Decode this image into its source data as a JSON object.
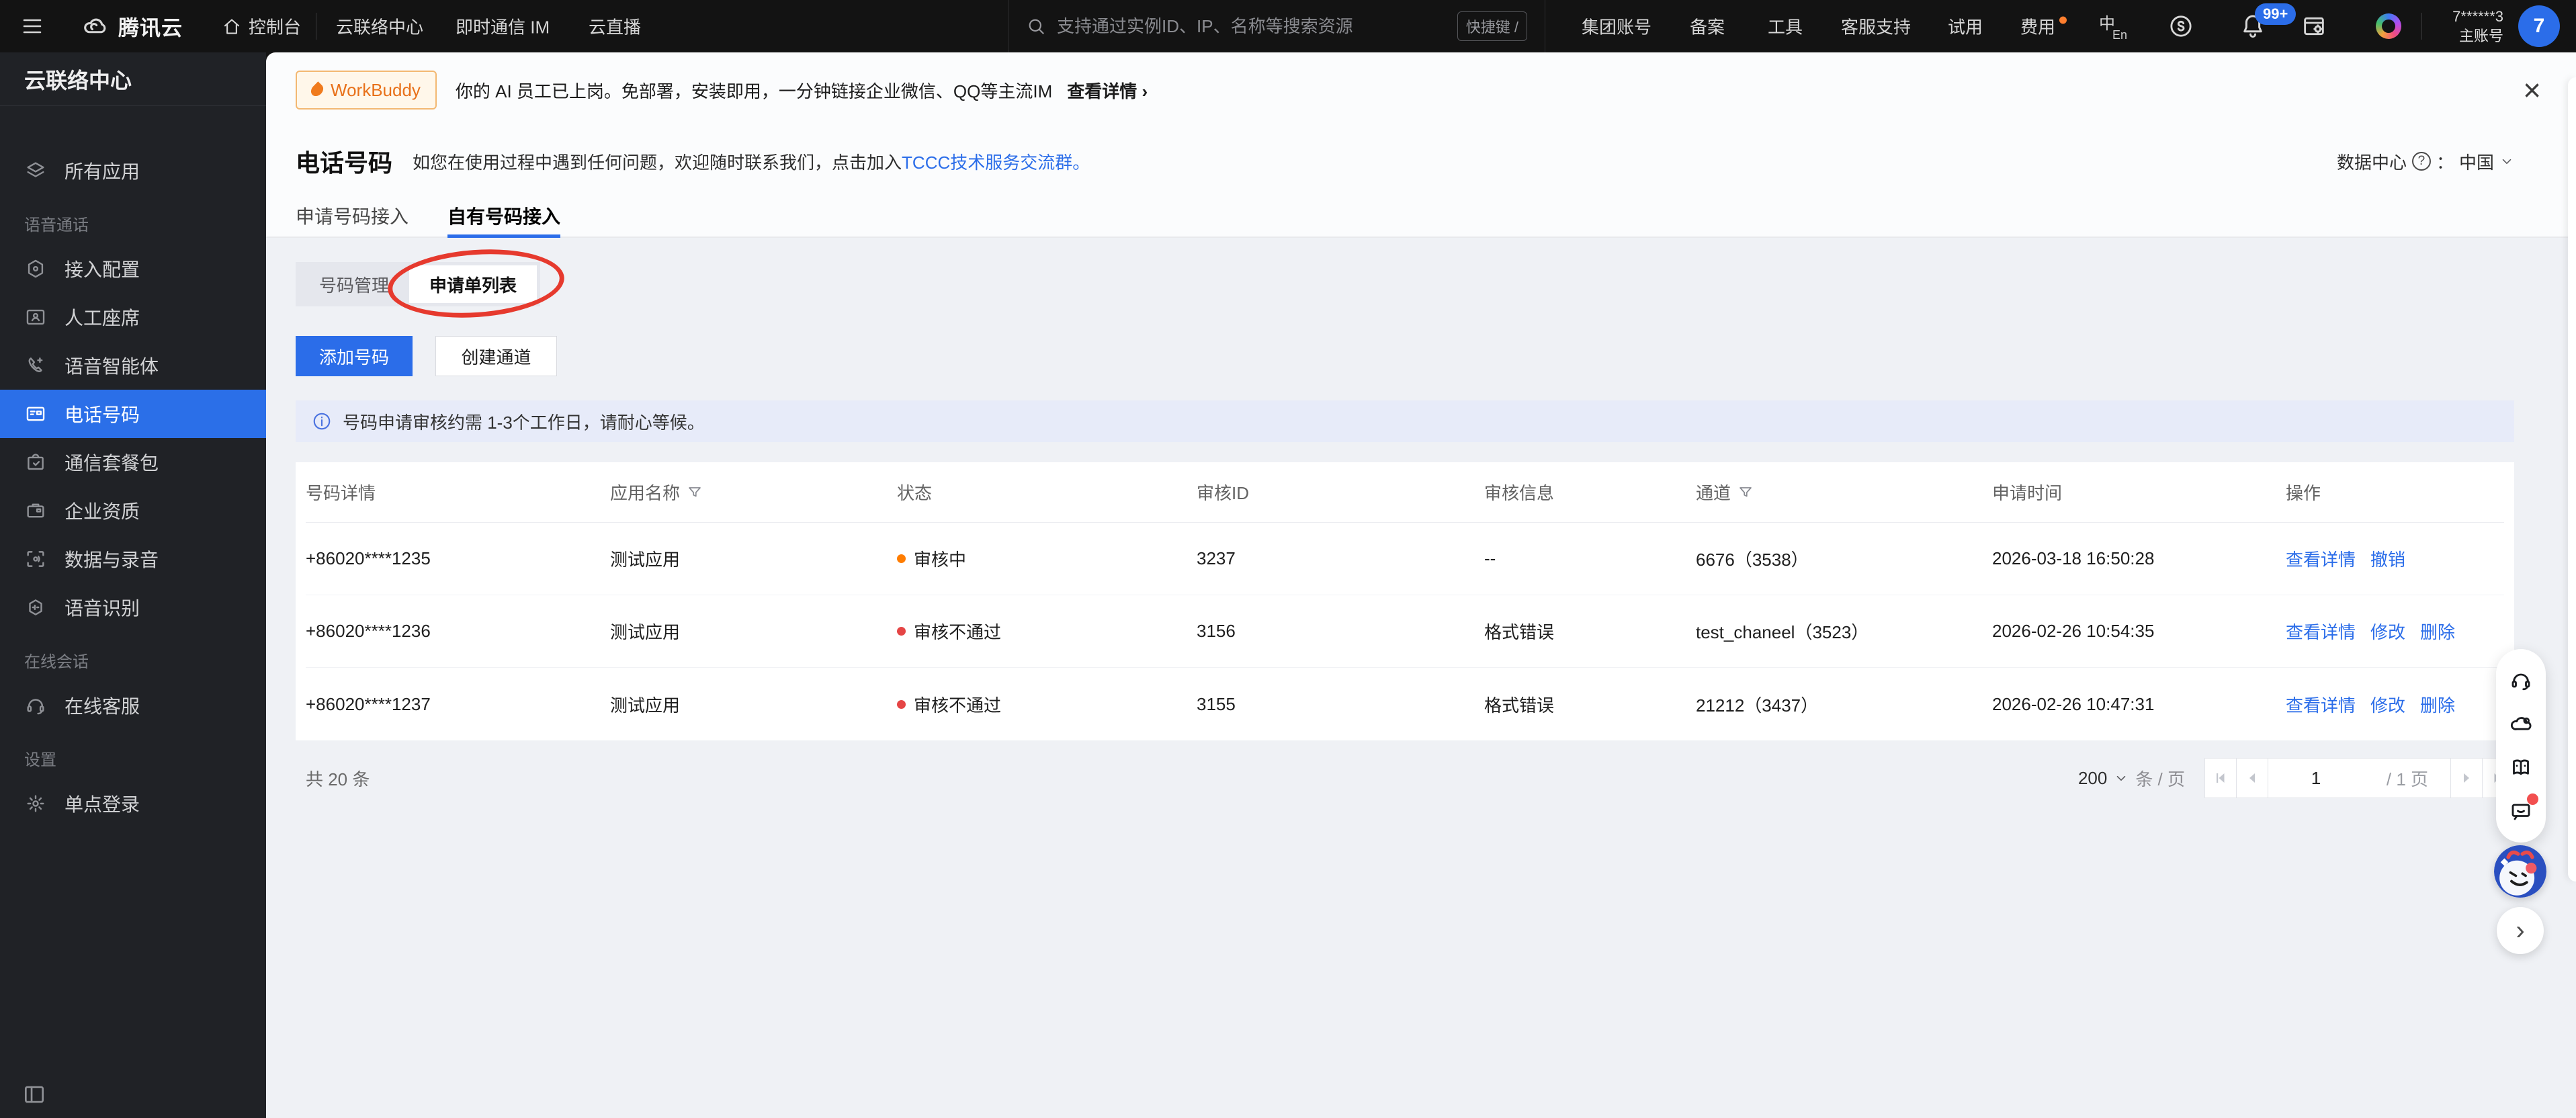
{
  "accent_color": "#2b6de9",
  "topbar": {
    "logo": "腾讯云",
    "nav": [
      "控制台",
      "云联络中心",
      "即时通信 IM",
      "云直播"
    ],
    "search": {
      "placeholder": "支持通过实例ID、IP、名称等搜索资源",
      "shortcut": "快捷键 /"
    },
    "menu": [
      "集团账号",
      "备案",
      "工具",
      "客服支持",
      "试用",
      "费用"
    ],
    "notification_badge": "99+",
    "account": {
      "id": "7******3",
      "role": "主账号",
      "avatar": "7"
    }
  },
  "sidebar": {
    "title": "云联络中心",
    "entries": [
      {
        "label": "所有应用"
      },
      {
        "label": "语音通话"
      },
      {
        "label": "接入配置"
      },
      {
        "label": "人工座席"
      },
      {
        "label": "语音智能体"
      },
      {
        "label": "电话号码"
      },
      {
        "label": "通信套餐包"
      },
      {
        "label": "企业资质"
      },
      {
        "label": "数据与录音"
      },
      {
        "label": "语音识别"
      },
      {
        "label": "在线会话"
      },
      {
        "label": "在线客服"
      },
      {
        "label": "设置"
      },
      {
        "label": "单点登录"
      }
    ]
  },
  "banner": {
    "tag": "WorkBuddy",
    "text": "你的 AI 员工已上岗。免部署，安装即用，一分钟链接企业微信、QQ等主流IM",
    "link": "查看详情 ›",
    "close": "×"
  },
  "page": {
    "title": "电话号码",
    "subtitle": "如您在使用过程中遇到任何问题，欢迎随时联系我们，点击加入",
    "subtitle_link": "TCCC技术服务交流群。",
    "datacenter_label": "数据中心",
    "datacenter_colon": "：",
    "datacenter_value": "中国"
  },
  "tabs": [
    {
      "label": "申请号码接入"
    },
    {
      "label": "自有号码接入"
    }
  ],
  "subtabs": [
    {
      "label": "号码管理"
    },
    {
      "label": "申请单列表"
    }
  ],
  "actions": {
    "add": "添加号码",
    "create": "创建通道"
  },
  "notice": "号码申请审核约需 1-3个工作日，请耐心等候。",
  "table": {
    "columns": [
      "号码详情",
      "应用名称",
      "状态",
      "审核ID",
      "审核信息",
      "通道",
      "申请时间",
      "操作"
    ],
    "status_colors": {
      "pending": "#ff7d00",
      "rejected": "#e54545"
    },
    "rows": [
      {
        "number": "+86020****1235",
        "app": "测试应用",
        "status": "审核中",
        "status_color": "#ff7d00",
        "audit_id": "3237",
        "audit_info": "--",
        "channel": "6676（3538）",
        "time": "2026-03-18 16:50:28",
        "ops": [
          "查看详情",
          "撤销"
        ]
      },
      {
        "number": "+86020****1236",
        "app": "测试应用",
        "status": "审核不通过",
        "status_color": "#e54545",
        "audit_id": "3156",
        "audit_info": "格式错误",
        "channel": "test_chaneel（3523）",
        "time": "2026-02-26 10:54:35",
        "ops": [
          "查看详情",
          "修改",
          "删除"
        ]
      },
      {
        "number": "+86020****1237",
        "app": "测试应用",
        "status": "审核不通过",
        "status_color": "#e54545",
        "audit_id": "3155",
        "audit_info": "格式错误",
        "channel": "21212（3437）",
        "time": "2026-02-26 10:47:31",
        "ops": [
          "查看详情",
          "修改",
          "删除"
        ]
      }
    ]
  },
  "pagination": {
    "total": "共 20 条",
    "page_size": "200",
    "unit": "条 / 页",
    "current": "1",
    "total_pages": "/ 1 页"
  }
}
